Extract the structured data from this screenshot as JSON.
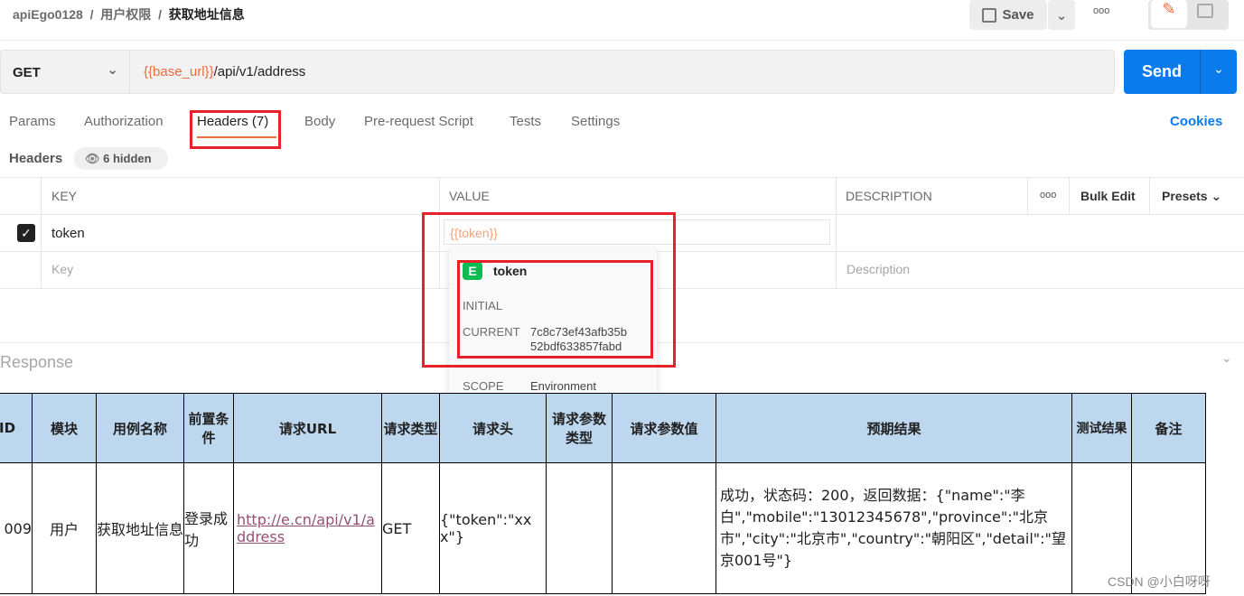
{
  "breadcrumb": {
    "workspace": "apiEgo0128",
    "folder": "用户权限",
    "request": "获取地址信息",
    "sep": "/"
  },
  "toolbar": {
    "save": "Save",
    "more": "ooo"
  },
  "request": {
    "method": "GET",
    "url_var": "{{base_url}}",
    "url_path": "/api/v1/address",
    "send": "Send"
  },
  "tabs": [
    {
      "label": "Params"
    },
    {
      "label": "Authorization"
    },
    {
      "label": "Headers (7)",
      "active": true
    },
    {
      "label": "Body"
    },
    {
      "label": "Pre-request Script"
    },
    {
      "label": "Tests"
    },
    {
      "label": "Settings"
    }
  ],
  "cookies": "Cookies",
  "headers_section": {
    "title": "Headers",
    "hidden": "6 hidden"
  },
  "header_table": {
    "columns": [
      "KEY",
      "VALUE",
      "DESCRIPTION"
    ],
    "more": "ooo",
    "bulk_edit": "Bulk Edit",
    "presets": "Presets",
    "rows": [
      {
        "key": "token",
        "value": "{{token}}",
        "checked": true
      }
    ],
    "placeholders": {
      "key": "Key",
      "description": "Description"
    }
  },
  "popup": {
    "badge": "E",
    "name": "token",
    "initial_label": "INITIAL",
    "current_label": "CURRENT",
    "current_value_1": "7c8c73ef43afb35b",
    "current_value_2": "52bdf633857fabd",
    "scope_label": "SCOPE",
    "scope_value": "Environment"
  },
  "response": {
    "label": "Response"
  },
  "excel": {
    "headers": [
      "ID",
      "模块",
      "用例名称",
      "前置条件",
      "请求URL",
      "请求类型",
      "请求头",
      "请求参数类型",
      "请求参数值",
      "预期结果",
      "测试结果",
      "备注"
    ],
    "row": {
      "id": "009",
      "module": "用户",
      "name": "获取地址信息",
      "pre": "登录成功",
      "url": "http://e.cn/api/v1/address",
      "type": "GET",
      "header": "{\"token\":\"xxx\"}",
      "ptype": "",
      "pval": "",
      "expected": "成功，状态码：200，返回数据：{\"name\":\"李白\",\"mobile\":\"13012345678\",\"province\":\"北京市\",\"city\":\"北京市\",\"country\":\"朝阳区\",\"detail\":\"望京001号\"}",
      "result": "",
      "note": ""
    }
  },
  "watermark": "CSDN @小白呀呀",
  "colors": {
    "accent": "#f26b3a",
    "send": "#097bed",
    "highlight": "#e8202a",
    "excel_header": "#bdd7ee",
    "env_badge": "#0cbb52"
  }
}
